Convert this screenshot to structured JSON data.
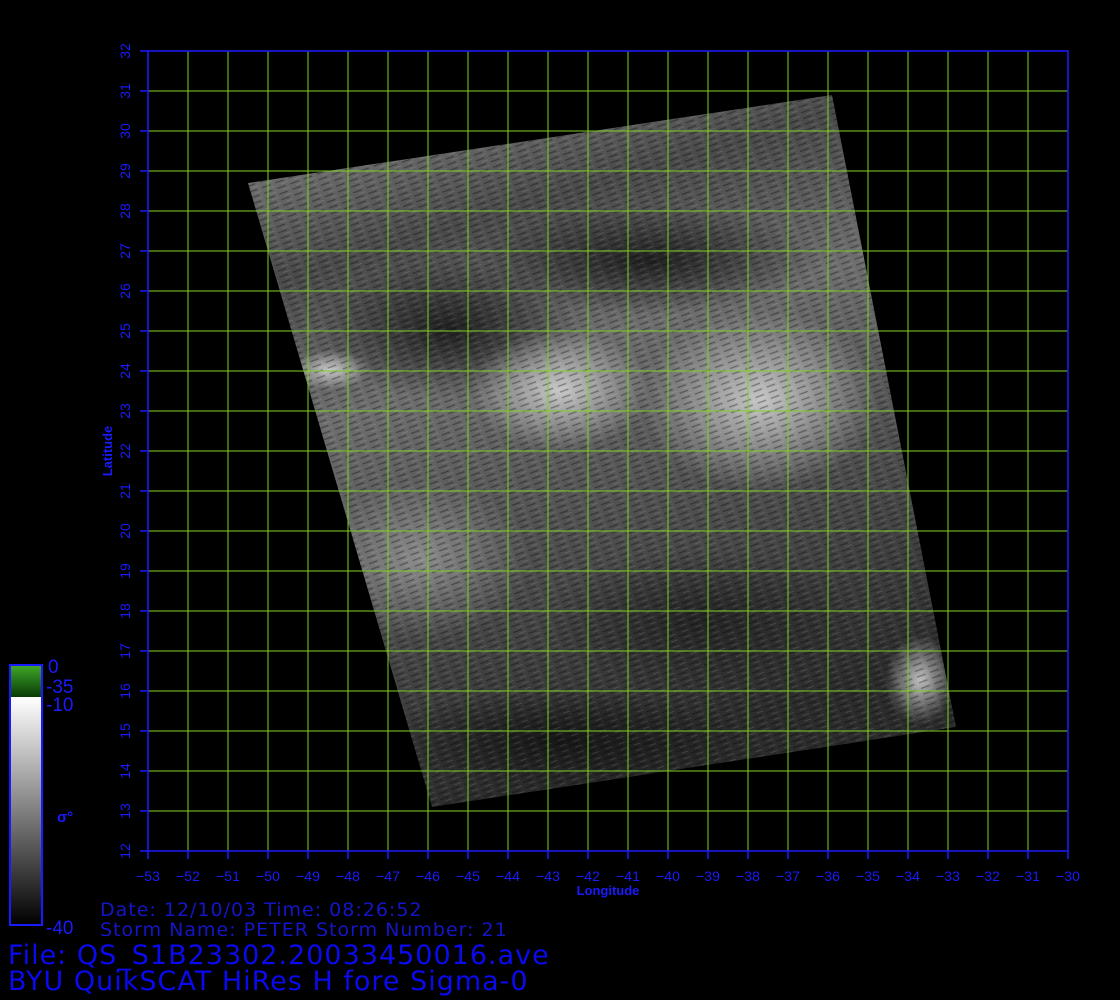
{
  "map": {
    "xlabel": "Longitude",
    "ylabel": "Latitude",
    "lon_range": [
      -53,
      -30
    ],
    "lat_range": [
      12,
      32
    ],
    "lon_ticks": [
      -53,
      -52,
      -51,
      -50,
      -49,
      -48,
      -47,
      -46,
      -45,
      -44,
      -43,
      -42,
      -41,
      -40,
      -39,
      -38,
      -37,
      -36,
      -35,
      -34,
      -33,
      -32,
      -31,
      -30
    ],
    "lat_ticks": [
      12,
      13,
      14,
      15,
      16,
      17,
      18,
      19,
      20,
      21,
      22,
      23,
      24,
      25,
      26,
      27,
      28,
      29,
      30,
      31,
      32
    ],
    "grid": true,
    "grid_color": "#7ed321",
    "axis_color": "#1a1aff",
    "swath_corners_lonlat": [
      [
        -50.5,
        28.7
      ],
      [
        -35.9,
        30.9
      ],
      [
        -32.8,
        15.1
      ],
      [
        -45.9,
        13.1
      ]
    ]
  },
  "colorbar": {
    "symbol": "σ°",
    "labels": {
      "top": "0",
      "green_bottom": "-35",
      "gray_top": "-10",
      "bottom": "-40"
    },
    "colors": {
      "green_top": "#3fa82a",
      "green_bottom": "#0a3a05",
      "gray_top": "#ffffff",
      "gray_bottom": "#000000"
    }
  },
  "meta": {
    "date_line": "Date: 12/10/03   Time: 08:26:52",
    "storm_line": "Storm Name: PETER   Storm Number: 21",
    "file_line": "File: QS_S1B23302.20033450016.ave",
    "title_line": "BYU QuikSCAT HiRes H fore Sigma-0"
  }
}
